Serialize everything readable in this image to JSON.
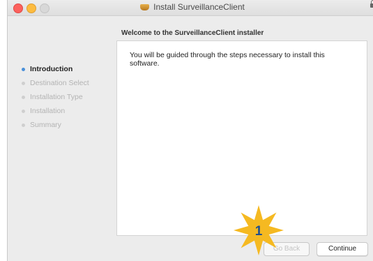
{
  "window": {
    "title": "Install SurveillanceClient"
  },
  "header": {
    "welcome": "Welcome to the SurveillanceClient installer"
  },
  "steps": [
    {
      "label": "Introduction",
      "active": true
    },
    {
      "label": "Destination Select",
      "active": false
    },
    {
      "label": "Installation Type",
      "active": false
    },
    {
      "label": "Installation",
      "active": false
    },
    {
      "label": "Summary",
      "active": false
    }
  ],
  "content": {
    "text": "You will be guided through the steps necessary to install this software."
  },
  "buttons": {
    "back_label": "Go Back",
    "continue_label": "Continue"
  },
  "badge": {
    "number": "1",
    "color": "#f5b921"
  },
  "colors": {
    "accent": "#4a90d9",
    "close": "#fc615d",
    "minimize": "#fdbc40"
  }
}
